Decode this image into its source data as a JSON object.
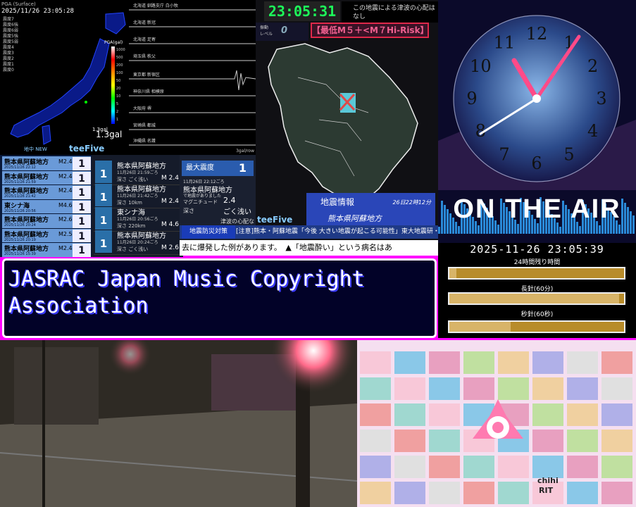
{
  "pga": {
    "header": "PGA (Surface)",
    "timestamp": "2025/11/26 23:05:28",
    "legend_lines": [
      "震度7",
      "震度6強",
      "震度6弱",
      "震度5強",
      "震度5弱",
      "震度4",
      "震度3",
      "震度2",
      "震度1",
      "震度0"
    ],
    "scale_label": "PGA(gal)",
    "scale_ticks": [
      "1000",
      "500",
      "200",
      "100",
      "50",
      "20",
      "10",
      "5",
      "2",
      "1"
    ],
    "small_value": "1.3gal",
    "value": "1.3gal",
    "new_label": "地中 NEW",
    "brand": "teeFive"
  },
  "seismograph": {
    "stations": [
      "北海道 釧路支庁 白小牧",
      "北海道 新冠",
      "北海道 足寄",
      "埼玉県 秩父",
      "東京都 新宿区",
      "神奈川県 相模原",
      "大阪府 堺",
      "宮崎県 都城",
      "沖縄県 名護"
    ],
    "footer": "3gal/row"
  },
  "kyushu_map": {
    "clock": "23:05:31",
    "notice_top": [
      "この地震による津波の心配はなし",
      ""
    ],
    "shindo_label": "振動\nレベル",
    "shindo_value": "0",
    "hi_risk": "【最低M５＋<M７Hi-Risk】",
    "info_title": "地震情報",
    "info_time": "26日22時12分",
    "info_place": "熊本県阿蘇地方",
    "brand": "teeFive"
  },
  "clock_video": {
    "numerals": [
      "12",
      "1",
      "2",
      "3",
      "4",
      "5",
      "6",
      "7",
      "8",
      "9",
      "10",
      "11"
    ],
    "on_air": "ON THE AIR"
  },
  "eq_list": [
    {
      "place": "熊本県阿蘇地方",
      "date": "2025/11/26 22:12",
      "mag": "M2.4",
      "shindo": "1"
    },
    {
      "place": "熊本県阿蘇地方",
      "date": "2025/11/26 21:59",
      "mag": "M2.4",
      "shindo": "1"
    },
    {
      "place": "熊本県阿蘇地方",
      "date": "2025/11/26 21:42",
      "mag": "M2.4",
      "shindo": "1"
    },
    {
      "place": "東シナ海",
      "date": "2025/11/26 20:56",
      "mag": "M4.6",
      "shindo": "1"
    },
    {
      "place": "熊本県阿蘇地方",
      "date": "2025/11/26 20:24",
      "mag": "M2.6",
      "shindo": "1"
    },
    {
      "place": "熊本県阿蘇地方",
      "date": "2025/11/26 20:19",
      "mag": "M2.5",
      "shindo": "1"
    },
    {
      "place": "熊本県阿蘇地方",
      "date": "2025/11/26 15:39",
      "mag": "M2.4",
      "shindo": "1"
    }
  ],
  "eq_detail": [
    {
      "shindo": "1",
      "place": "熊本県阿蘇地方",
      "time": "11月26日 21:59ごろ",
      "depth": "深さ ごく浅い",
      "mag": "M 2.4"
    },
    {
      "shindo": "1",
      "place": "熊本県阿蘇地方",
      "time": "11月26日 21:42ごろ",
      "depth": "深さ 10km",
      "mag": "M 2.4"
    },
    {
      "shindo": "1",
      "place": "東シナ海",
      "time": "11月26日 20:56ごろ",
      "depth": "深さ 220km",
      "mag": "M 4.6"
    },
    {
      "shindo": "1",
      "place": "熊本県阿蘇地方",
      "time": "11月26日 20:24ごろ",
      "depth": "深さ ごく浅い",
      "mag": "M 2.6"
    }
  ],
  "max_shindo": {
    "label": "最大震度",
    "value": "1",
    "datetime": "11月26日 22:12ごろ",
    "place": "熊本県阿蘇地方",
    "sub": "で地震がありました",
    "mag_label": "マグニチュード",
    "mag_value": "2.4",
    "depth_label": "深さ",
    "depth_value": "ごく浅い",
    "tsunami": "津波の心配なし"
  },
  "ticker": {
    "tag": "地震防災対策",
    "line1": "[注意]熊本・阿蘇地震「今後 大きい地震が起こる可能性」東大地震研・笠原教授",
    "line2": "去に爆発した例があります。　▲「地震酔い」という病名はあ"
  },
  "progress": {
    "datetime": "2025-11-26 23:05:39",
    "bars": [
      {
        "label": "24時間残り時間",
        "fraction": 0.04
      },
      {
        "label": "長針(60分)",
        "fraction": 0.97
      },
      {
        "label": "秒針(60秒)",
        "fraction": 0.35
      }
    ]
  },
  "jasrac": {
    "line1": "JASRAC Japan Music Copyright",
    "line2": "Association"
  },
  "thumbs": {
    "labels": [
      "chihi",
      "RIT"
    ]
  }
}
